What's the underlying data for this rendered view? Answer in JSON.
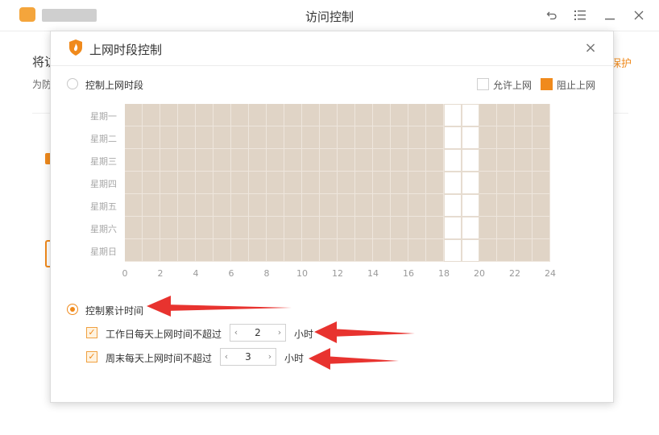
{
  "window": {
    "title": "访问控制"
  },
  "background": {
    "heading": "将访",
    "description": "为防",
    "link": "保护"
  },
  "dialog": {
    "title": "上网时段控制",
    "option_period": "控制上网时段",
    "option_cumulative": "控制累计时间",
    "legend_allow": "允许上网",
    "legend_block": "阻止上网",
    "days": [
      "星期一",
      "星期二",
      "星期三",
      "星期四",
      "星期五",
      "星期六",
      "星期日"
    ],
    "ticks": [
      "0",
      "2",
      "4",
      "6",
      "8",
      "10",
      "12",
      "14",
      "16",
      "18",
      "20",
      "22",
      "24"
    ],
    "allowed_hours": [
      18,
      19
    ],
    "weekday_label": "工作日每天上网时间不超过",
    "weekday_value": "2",
    "weekend_label": "周末每天上网时间不超过",
    "weekend_value": "3",
    "unit": "小时"
  },
  "colors": {
    "accent": "#f08a1c",
    "blocked": "#e0d4c6",
    "allowed": "#ffffff",
    "arrow": "#e8332f"
  },
  "icons": {
    "back": "back-icon",
    "menu": "menu-icon",
    "minimize": "minimize-icon",
    "close": "close-icon",
    "shield": "shield-icon",
    "decrease": "chevron-left-icon",
    "increase": "chevron-right-icon"
  }
}
